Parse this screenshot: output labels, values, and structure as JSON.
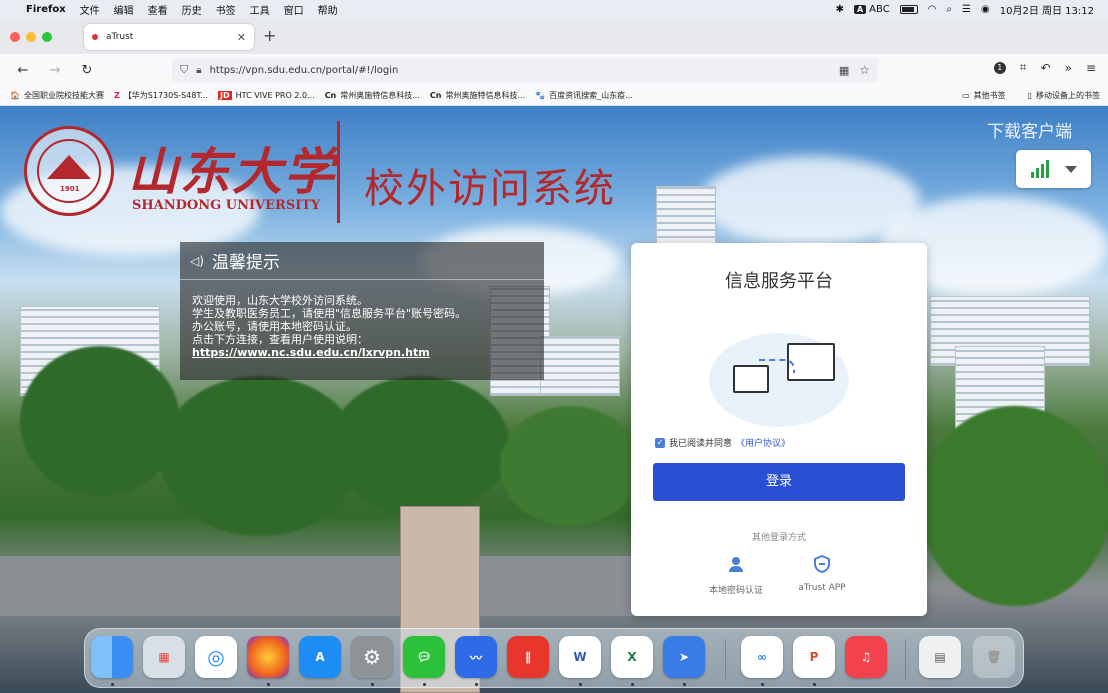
{
  "menubar": {
    "app": "Firefox",
    "items": [
      "文件",
      "编辑",
      "查看",
      "历史",
      "书签",
      "工具",
      "窗口",
      "帮助"
    ],
    "input_method": "ABC",
    "datetime": "10月2日 周日  13:12"
  },
  "browser": {
    "tab_title": "aTrust",
    "url": "https://vpn.sdu.edu.cn/portal/#!/login",
    "extension_badge": "1",
    "bookmarks": [
      {
        "icon": "🏠",
        "label": "全国职业院校技能大赛"
      },
      {
        "icon": "Z",
        "label": "【华为S1730S-S48T..."
      },
      {
        "icon": "JD",
        "label": "HTC VIVE PRO 2.0..."
      },
      {
        "icon": "Cn",
        "label": "常州奥施特信息科技..."
      },
      {
        "icon": "Cn",
        "label": "常州奥施特信息科技..."
      },
      {
        "icon": "🐾",
        "label": "百度资讯搜索_山东疫..."
      }
    ],
    "bookmarks_right": [
      "其他书签",
      "移动设备上的书签"
    ]
  },
  "page": {
    "logo_cn": "山东大学",
    "logo_en": "SHANDONG UNIVERSITY",
    "seal_year": "1901",
    "system_title": "校外访问系统",
    "download_client": "下载客户端",
    "notice": {
      "title": "温馨提示",
      "lines": [
        "欢迎使用，山东大学校外访问系统。",
        "学生及教职医务员工，请使用\"信息服务平台\"账号密码。",
        "办公账号，请使用本地密码认证。",
        "点击下方连接，查看用户使用说明："
      ],
      "link": "https://www.nc.sdu.edu.cn/lxrvpn.htm"
    },
    "login": {
      "title": "信息服务平台",
      "agree_text": "我已阅读并同意",
      "agree_link": "《用户协议》",
      "login_button": "登录",
      "other_methods": "其他登录方式",
      "method_local": "本地密码认证",
      "method_app": "aTrust APP"
    }
  },
  "colors": {
    "sdu_red": "#b2282c",
    "login_blue": "#2b4fd3",
    "signal_green": "#27a243"
  },
  "dock": {
    "apps": [
      "finder",
      "launchpad",
      "safari",
      "firefox",
      "app-store",
      "system-settings",
      "wechat",
      "feishu",
      "huawei-app",
      "word",
      "excel",
      "atrust",
      "baidu-netdisk",
      "powerpoint",
      "music",
      "screenshot",
      "trash"
    ]
  }
}
